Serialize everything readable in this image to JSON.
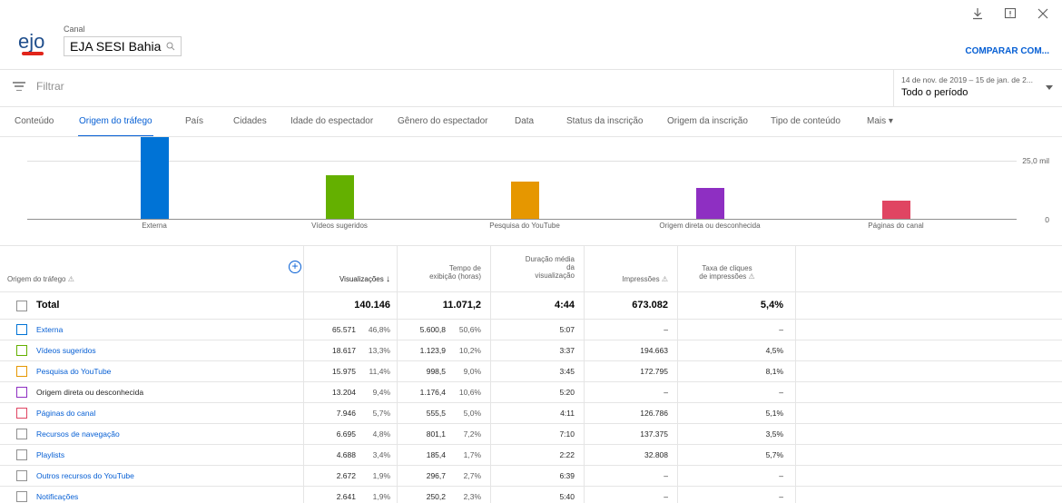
{
  "header": {
    "channel_label": "Canal",
    "channel_name": "EJA SESI Bahia",
    "compare_label": "COMPARAR COM..."
  },
  "filter": {
    "label": "Filtrar"
  },
  "date": {
    "range": "14 de nov. de 2019 – 15 de jan. de 2...",
    "period": "Todo o período"
  },
  "tabs": [
    "Conteúdo",
    "Origem do tráfego",
    "País",
    "Cidades",
    "Idade do espectador",
    "Gênero do espectador",
    "Data",
    "Status da inscrição",
    "Origem da inscrição",
    "Tipo de conteúdo",
    "Mais"
  ],
  "chart_data": {
    "type": "bar",
    "categories": [
      "Externa",
      "Vídeos sugeridos",
      "Pesquisa do YouTube",
      "Origem direta ou desconhecida",
      "Páginas do canal"
    ],
    "values": [
      65571,
      18617,
      15975,
      13204,
      7946
    ],
    "colors": [
      "#0073d6",
      "#64b000",
      "#e69700",
      "#8e2fc2",
      "#e04562"
    ],
    "y_ticks": [
      "25,0 mil",
      "0"
    ],
    "ylim": [
      0,
      37500
    ]
  },
  "table": {
    "headers": {
      "source": "Origem do tráfego",
      "views": "Visualizações",
      "watch_time": [
        "Tempo de",
        "exibição (horas)"
      ],
      "avg_duration": [
        "Duração média",
        "da",
        "visualização"
      ],
      "impressions": "Impressões",
      "ctr": [
        "Taxa de cliques",
        "de impressões"
      ]
    },
    "total": {
      "label": "Total",
      "views": "140.146",
      "watch_time": "11.071,2",
      "avg_duration": "4:44",
      "impressions": "673.082",
      "ctr": "5,4%"
    },
    "rows": [
      {
        "label": "Externa",
        "color": "#0073d6",
        "link": true,
        "views": "65.571",
        "views_pct": "46,8%",
        "watch": "5.600,8",
        "watch_pct": "50,6%",
        "dur": "5:07",
        "impr": "–",
        "ctr": "–"
      },
      {
        "label": "Vídeos sugeridos",
        "color": "#64b000",
        "link": true,
        "views": "18.617",
        "views_pct": "13,3%",
        "watch": "1.123,9",
        "watch_pct": "10,2%",
        "dur": "3:37",
        "impr": "194.663",
        "ctr": "4,5%"
      },
      {
        "label": "Pesquisa do YouTube",
        "color": "#e69700",
        "link": true,
        "views": "15.975",
        "views_pct": "11,4%",
        "watch": "998,5",
        "watch_pct": "9,0%",
        "dur": "3:45",
        "impr": "172.795",
        "ctr": "8,1%"
      },
      {
        "label": "Origem direta ou desconhecida",
        "color": "#8e2fc2",
        "link": false,
        "views": "13.204",
        "views_pct": "9,4%",
        "watch": "1.176,4",
        "watch_pct": "10,6%",
        "dur": "5:20",
        "impr": "–",
        "ctr": "–"
      },
      {
        "label": "Páginas do canal",
        "color": "#e04562",
        "link": true,
        "views": "7.946",
        "views_pct": "5,7%",
        "watch": "555,5",
        "watch_pct": "5,0%",
        "dur": "4:11",
        "impr": "126.786",
        "ctr": "5,1%"
      },
      {
        "label": "Recursos de navegação",
        "color": "#909090",
        "link": true,
        "views": "6.695",
        "views_pct": "4,8%",
        "watch": "801,1",
        "watch_pct": "7,2%",
        "dur": "7:10",
        "impr": "137.375",
        "ctr": "3,5%"
      },
      {
        "label": "Playlists",
        "color": "#909090",
        "link": true,
        "views": "4.688",
        "views_pct": "3,4%",
        "watch": "185,4",
        "watch_pct": "1,7%",
        "dur": "2:22",
        "impr": "32.808",
        "ctr": "5,7%"
      },
      {
        "label": "Outros recursos do YouTube",
        "color": "#909090",
        "link": true,
        "views": "2.672",
        "views_pct": "1,9%",
        "watch": "296,7",
        "watch_pct": "2,7%",
        "dur": "6:39",
        "impr": "–",
        "ctr": "–"
      },
      {
        "label": "Notificações",
        "color": "#909090",
        "link": true,
        "views": "2.641",
        "views_pct": "1,9%",
        "watch": "250,2",
        "watch_pct": "2,3%",
        "dur": "5:40",
        "impr": "–",
        "ctr": "–"
      }
    ]
  },
  "colors": {
    "link": "#065fd4",
    "active_tab": "#065fd4"
  }
}
